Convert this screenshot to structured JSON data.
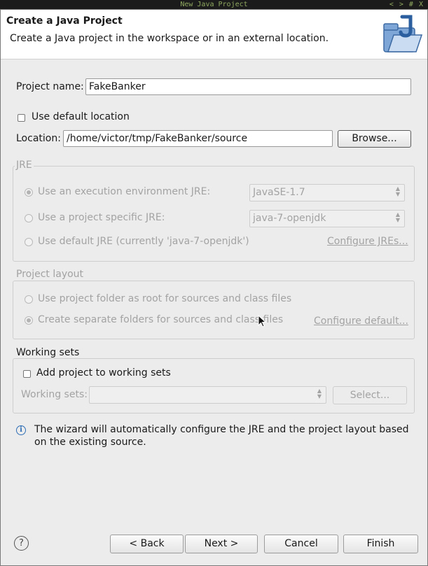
{
  "window": {
    "title": "New Java Project",
    "controls": "< > # X"
  },
  "header": {
    "title": "Create a Java Project",
    "description": "Create a Java project in the workspace or in an external location.",
    "icon": "java-project-folder-icon"
  },
  "project_name": {
    "label": "Project name:",
    "value": "FakeBanker"
  },
  "default_location": {
    "label": "Use default location",
    "checked": false
  },
  "location": {
    "label": "Location:",
    "value": "/home/victor/tmp/FakeBanker/source",
    "browse": "Browse..."
  },
  "jre": {
    "legend": "JRE",
    "opt_env": "Use an execution environment JRE:",
    "env_value": "JavaSE-1.7",
    "opt_specific": "Use a project specific JRE:",
    "specific_value": "java-7-openjdk",
    "opt_default": "Use default JRE (currently 'java-7-openjdk')",
    "configure": "Configure JREs..."
  },
  "layout": {
    "legend": "Project layout",
    "opt_root": "Use project folder as root for sources and class files",
    "opt_separate": "Create separate folders for sources and class files",
    "configure": "Configure default..."
  },
  "working_sets": {
    "legend": "Working sets",
    "add_label": "Add project to working sets",
    "sets_label": "Working sets:",
    "sets_value": "",
    "select": "Select..."
  },
  "info": {
    "text1": "The wizard will automatically configure the JRE and the project layout based",
    "text2": "on the existing source."
  },
  "footer": {
    "back": "< Back",
    "next": "Next >",
    "cancel": "Cancel",
    "finish": "Finish"
  }
}
